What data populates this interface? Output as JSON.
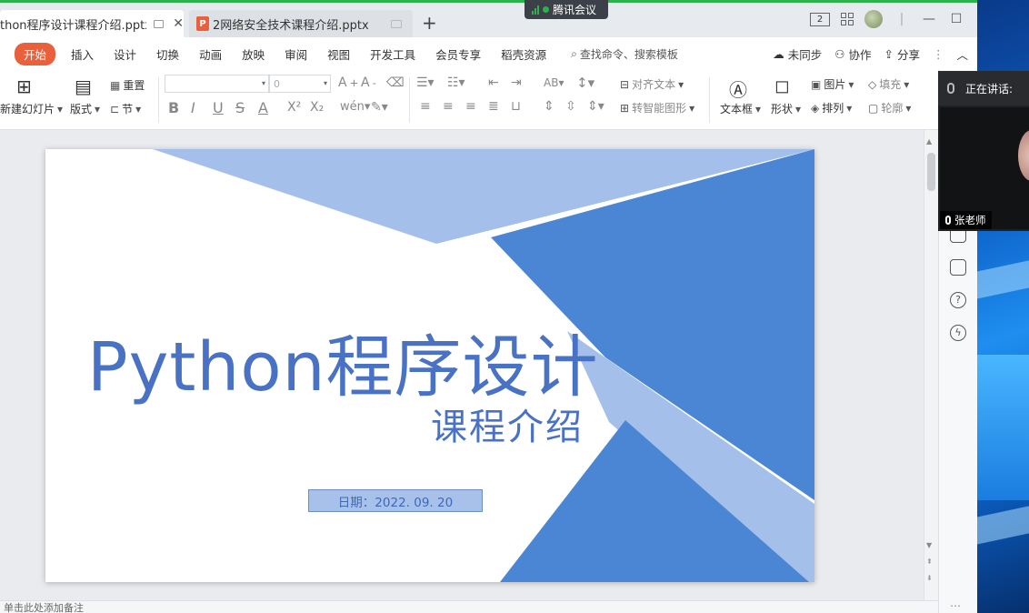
{
  "meeting": {
    "label": "腾讯会议"
  },
  "tabs": [
    {
      "label": "thon程序设计课程介绍.pptx",
      "active": true
    },
    {
      "label": "2网络安全技术课程介绍.pptx",
      "icon": "P",
      "active": false
    }
  ],
  "window_controls": {
    "new_tab": "+",
    "layout_badge": "2",
    "minimize": "—",
    "maximize": "☐",
    "close": "✕"
  },
  "menu": {
    "items": [
      "开始",
      "插入",
      "设计",
      "切换",
      "动画",
      "放映",
      "审阅",
      "视图",
      "开发工具",
      "会员专享",
      "稻壳资源"
    ],
    "search_placeholder": "查找命令、搜索模板",
    "right": [
      "未同步",
      "协作",
      "分享"
    ]
  },
  "ribbon": {
    "new_slide": "新建幻灯片",
    "layout": "版式",
    "reset": "重置",
    "section": "节",
    "font_name": "",
    "font_size": "0",
    "align_text": "对齐文本",
    "smart_art": "转智能图形",
    "textbox": "文本框",
    "shape": "形状",
    "picture": "图片",
    "arrange": "排列",
    "fill": "填充",
    "outline": "轮廓",
    "font_style_icons": [
      "B",
      "I",
      "U",
      "S",
      "A",
      "X²",
      "X₂"
    ]
  },
  "slide": {
    "title": "Python程序设计",
    "subtitle": "课程介绍",
    "date": "日期：2022. 09. 20",
    "colors": {
      "light_blue": "#a4c0ea",
      "mid_blue": "#4a86d4",
      "text_blue": "#4a72c4"
    }
  },
  "statusbar": {
    "text": "单击此处添加备注"
  },
  "speaker_panel": {
    "header": "正在讲话:",
    "name": "张老师"
  }
}
